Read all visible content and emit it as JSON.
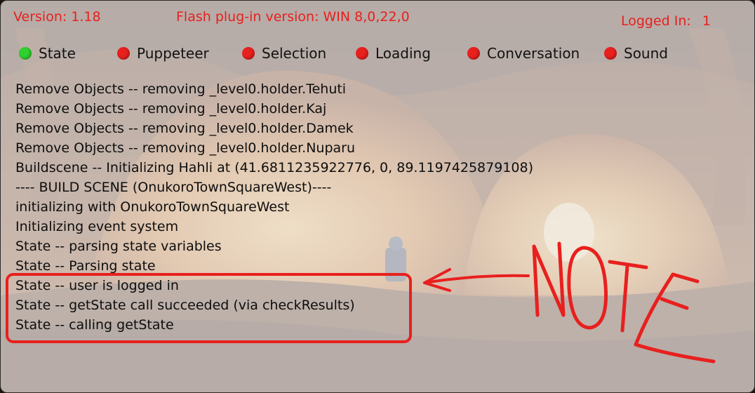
{
  "header": {
    "version_label": "Version: 1.18",
    "flash_label": "Flash plug-in version: WIN 8,0,22,0",
    "logged_in_label": "Logged In:",
    "logged_in_count": "1"
  },
  "status_indicators": [
    {
      "label": "State",
      "status": "green",
      "color": "#2fd02f"
    },
    {
      "label": "Puppeteer",
      "status": "red",
      "color": "#e8201e"
    },
    {
      "label": "Selection",
      "status": "red",
      "color": "#e8201e"
    },
    {
      "label": "Loading",
      "status": "red",
      "color": "#e8201e"
    },
    {
      "label": "Conversation",
      "status": "red",
      "color": "#e8201e"
    },
    {
      "label": "Sound",
      "status": "red",
      "color": "#e8201e"
    }
  ],
  "log_lines": [
    "Remove Objects -- removing _level0.holder.Tehuti",
    "Remove Objects -- removing _level0.holder.Kaj",
    "Remove Objects -- removing _level0.holder.Damek",
    "Remove Objects -- removing _level0.holder.Nuparu",
    "Buildscene -- Initializing Hahli at (41.6811235922776, 0, 89.1197425879108)",
    "---- BUILD SCENE (OnukoroTownSquareWest)----",
    "initializing with OnukoroTownSquareWest",
    "Initializing event system",
    "State -- parsing state variables",
    "State -- Parsing state",
    "State -- user is logged in",
    "State -- getState call succeeded (via checkResults)",
    "State -- calling getState"
  ],
  "annotation": {
    "note_text": "NOTE",
    "color": "#e8201e"
  },
  "colors": {
    "header_text": "#e8201e",
    "body_text": "#0e0e0e"
  }
}
